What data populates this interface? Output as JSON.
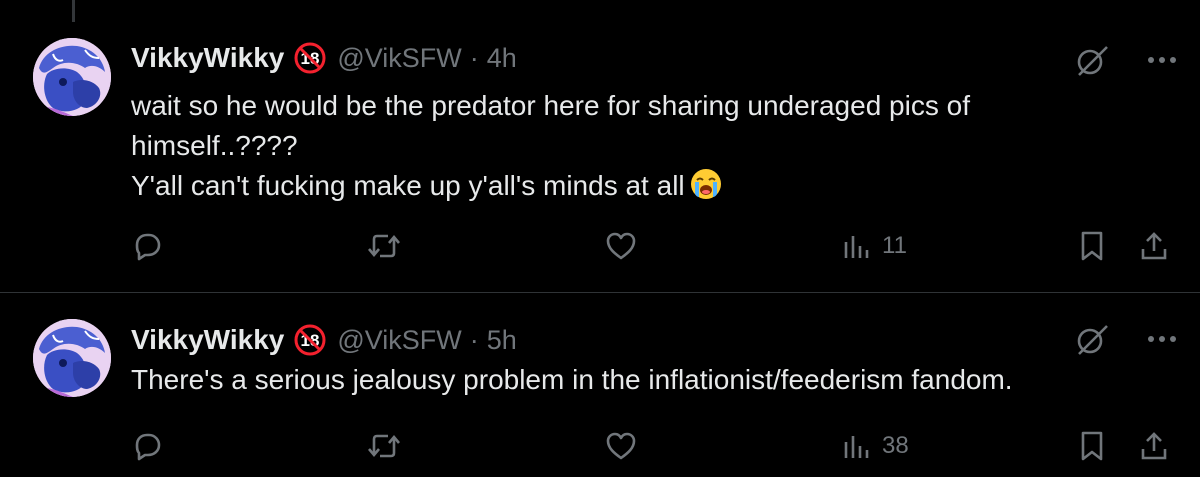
{
  "colors": {
    "background": "#000000",
    "text": "#e7e9ea",
    "secondary": "#71767b",
    "divider": "#2f3336",
    "badge_red": "#f4212e"
  },
  "tweets": [
    {
      "author": {
        "name": "VikkyWikky",
        "badge_icon": "no-18-icon",
        "handle": "@VikSFW"
      },
      "separator": "·",
      "time": "4h",
      "lines": [
        "wait so he would be the predator here for sharing underaged pics of",
        "himself..????",
        "Y'all can't fucking make up y'all's minds at all"
      ],
      "trailing_emoji": "loudly-crying-face-icon",
      "views": "11",
      "icons": {
        "reply": "reply-icon",
        "retweet": "retweet-icon",
        "like": "heart-icon",
        "views": "views-icon",
        "bookmark": "bookmark-icon",
        "share": "share-icon",
        "grok": "grok-icon",
        "more": "more-icon"
      }
    },
    {
      "author": {
        "name": "VikkyWikky",
        "badge_icon": "no-18-icon",
        "handle": "@VikSFW"
      },
      "separator": "·",
      "time": "5h",
      "lines": [
        "There's a serious jealousy problem in the inflationist/feederism fandom."
      ],
      "views": "38"
    }
  ]
}
